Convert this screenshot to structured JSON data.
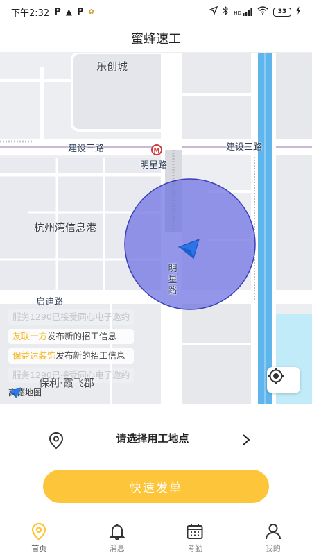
{
  "status_bar": {
    "time": "下午2:32",
    "left_icons": [
      "parking-icon",
      "warning-icon",
      "parking-icon",
      "app-notification-icon"
    ],
    "right_icons": [
      "location-arrow-icon",
      "bluetooth-icon",
      "signal-icon",
      "wifi-icon",
      "charging-icon"
    ],
    "network": "HD",
    "battery": "33"
  },
  "header": {
    "title": "蜜蜂速工"
  },
  "map": {
    "place_labels": {
      "le_chuang_cheng": "乐创城",
      "hangzhou_wan": "杭州湾信息港",
      "baoli": "保利·霞飞郡"
    },
    "road_labels": {
      "jianshe_left": "建设三路",
      "jianshe_right": "建设三路",
      "mingxing": "明星路",
      "mingxing_vertical": "明星路",
      "qidi": "启迪路"
    },
    "notices": [
      {
        "text": "服务1290已接受同心电子邀约",
        "faded": true
      },
      {
        "company": "友联一方",
        "text": "发布新的招工信息",
        "faded": false
      },
      {
        "company": "保益达装饰",
        "text": "发布新的招工信息",
        "faded": false
      },
      {
        "text": "服务1290已接受同心电子邀约",
        "faded": true
      }
    ],
    "logo_text": "高德地图",
    "colors": {
      "accuracy_circle": "#6b6fe0",
      "river": "#5fb6ec",
      "park": "#bfe9f9"
    }
  },
  "location_row": {
    "label": "请选择用工地点"
  },
  "quick_order": {
    "label": "快速发单",
    "color": "#fcc53a"
  },
  "tabs": [
    {
      "label": "首页",
      "icon": "location-pin-icon",
      "active": true
    },
    {
      "label": "消息",
      "icon": "bell-icon",
      "active": false
    },
    {
      "label": "考勤",
      "icon": "calendar-icon",
      "active": false
    },
    {
      "label": "我的",
      "icon": "user-icon",
      "active": false
    }
  ]
}
